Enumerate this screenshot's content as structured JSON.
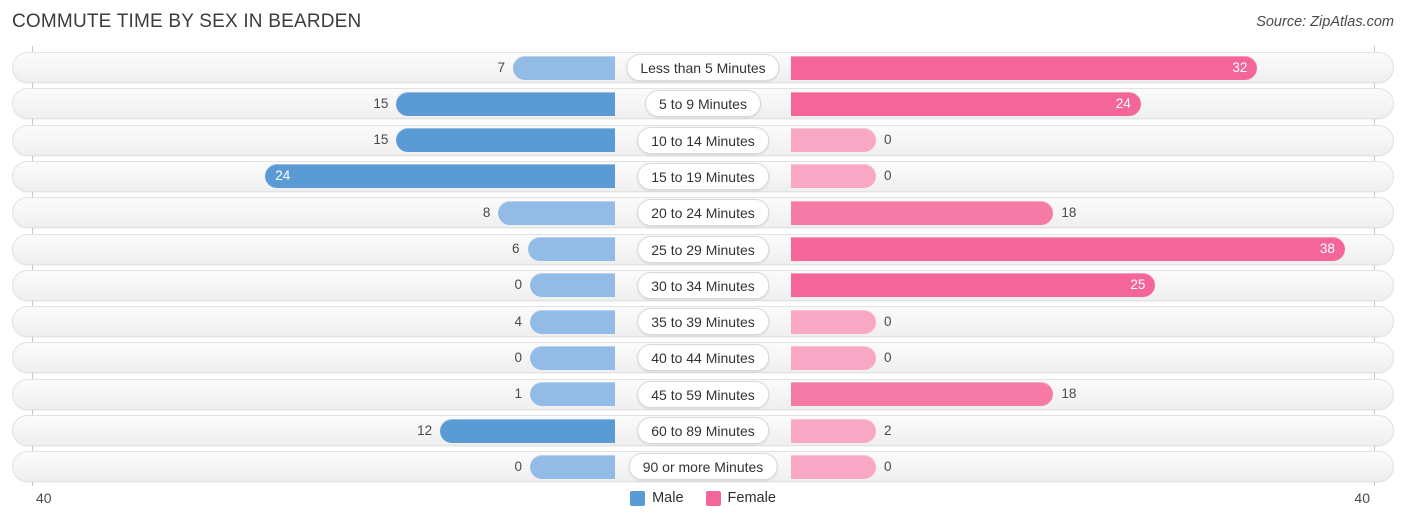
{
  "header": {
    "title": "COMMUTE TIME BY SEX IN BEARDEN",
    "source": "Source: ZipAtlas.com"
  },
  "legend": {
    "male_label": "Male",
    "female_label": "Female",
    "male_color": "#5b9bd5",
    "female_color": "#f4669a"
  },
  "axis": {
    "left_tick": "40",
    "right_tick": "40"
  },
  "chart_data": {
    "type": "bar",
    "subtype": "diverging-bidirectional",
    "title": "COMMUTE TIME BY SEX IN BEARDEN",
    "xlabel": "",
    "ylabel": "",
    "xlim": [
      40,
      40
    ],
    "axis_max": 40,
    "grid": false,
    "legend_position": "bottom-center",
    "categories": [
      "Less than 5 Minutes",
      "5 to 9 Minutes",
      "10 to 14 Minutes",
      "15 to 19 Minutes",
      "20 to 24 Minutes",
      "25 to 29 Minutes",
      "30 to 34 Minutes",
      "35 to 39 Minutes",
      "40 to 44 Minutes",
      "45 to 59 Minutes",
      "60 to 89 Minutes",
      "90 or more Minutes"
    ],
    "series": [
      {
        "name": "Male",
        "color": "#5b9bd5",
        "direction": "left",
        "values": [
          7,
          15,
          15,
          24,
          8,
          6,
          0,
          4,
          0,
          1,
          12,
          0
        ]
      },
      {
        "name": "Female",
        "color": "#f4669a",
        "direction": "right",
        "values": [
          32,
          24,
          0,
          0,
          18,
          38,
          25,
          0,
          0,
          18,
          2,
          0
        ]
      }
    ]
  },
  "rows": [
    {
      "label": "Less than 5 Minutes",
      "male": "7",
      "female": "32",
      "male_inside": false,
      "female_inside": true
    },
    {
      "label": "5 to 9 Minutes",
      "male": "15",
      "female": "24",
      "male_inside": false,
      "female_inside": true
    },
    {
      "label": "10 to 14 Minutes",
      "male": "15",
      "female": "0",
      "male_inside": false,
      "female_inside": false
    },
    {
      "label": "15 to 19 Minutes",
      "male": "24",
      "female": "0",
      "male_inside": true,
      "female_inside": false
    },
    {
      "label": "20 to 24 Minutes",
      "male": "8",
      "female": "18",
      "male_inside": false,
      "female_inside": false
    },
    {
      "label": "25 to 29 Minutes",
      "male": "6",
      "female": "38",
      "male_inside": false,
      "female_inside": true
    },
    {
      "label": "30 to 34 Minutes",
      "male": "0",
      "female": "25",
      "male_inside": false,
      "female_inside": true
    },
    {
      "label": "35 to 39 Minutes",
      "male": "4",
      "female": "0",
      "male_inside": false,
      "female_inside": false
    },
    {
      "label": "40 to 44 Minutes",
      "male": "0",
      "female": "0",
      "male_inside": false,
      "female_inside": false
    },
    {
      "label": "45 to 59 Minutes",
      "male": "1",
      "female": "18",
      "male_inside": false,
      "female_inside": false
    },
    {
      "label": "60 to 89 Minutes",
      "male": "12",
      "female": "2",
      "male_inside": false,
      "female_inside": false
    },
    {
      "label": "90 or more Minutes",
      "male": "0",
      "female": "0",
      "male_inside": false,
      "female_inside": false
    }
  ]
}
